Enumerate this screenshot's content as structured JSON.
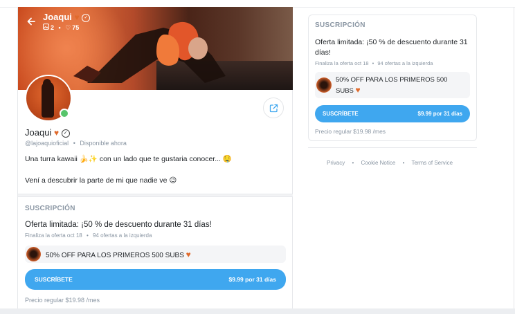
{
  "profile": {
    "name": "Joaqui",
    "handle": "@lajoaquioficial",
    "status": "Disponible ahora",
    "media_count": "2",
    "likes_count": "75",
    "bio_line1": "Una turra kawaii 🍌✨ con un lado que te gustaria conocer... 🤤",
    "bio_line2": "Vení a descubrir la parte de mi que nadie ve 😉"
  },
  "subscription": {
    "title": "SUSCRIPCIÓN",
    "offer": "Oferta limitada: ¡50 % de descuento durante 31 días!",
    "offer_line1": "Oferta limitada: ¡50 % de descuento durante 31",
    "offer_line2": "días!",
    "ends": "Finaliza la oferta oct 18",
    "remaining": "94 ofertas a la izquierda",
    "promo_text": "50% OFF PARA LOS PRIMEROS 500 SUBS",
    "promo_line1": "50% OFF PARA LOS PRIMEROS 500",
    "promo_line2": "SUBS",
    "button_label": "SUSCRÍBETE",
    "button_price": "$9.99 por 31 días",
    "regular_price": "Precio regular $19.98 /mes"
  },
  "footer": {
    "links": [
      "Privacy",
      "Cookie Notice",
      "Terms of Service"
    ]
  },
  "icons": {
    "back": "arrow-left-icon",
    "share": "share-icon",
    "media": "image-icon",
    "likes": "heart-outline-icon",
    "verified": "verified-badge-icon",
    "heart": "heart-icon"
  },
  "colors": {
    "accent": "#3fa7ef",
    "online": "#57c46b",
    "heart": "#e06a2c",
    "muted": "#8a96a3"
  }
}
